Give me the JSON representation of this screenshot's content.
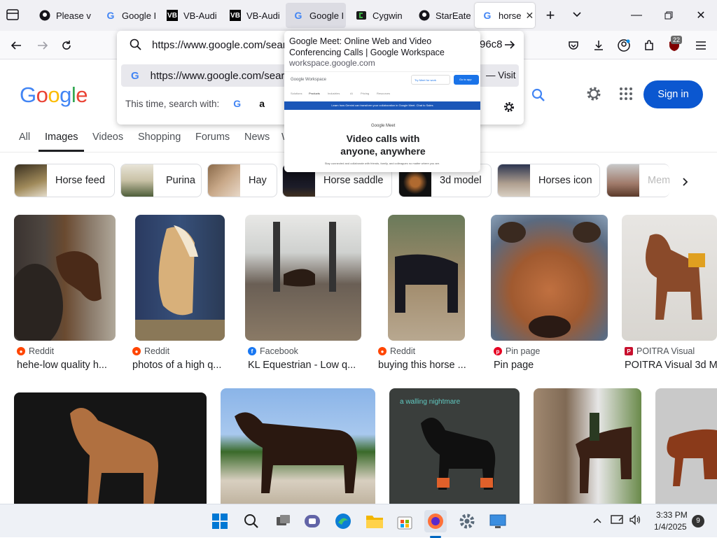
{
  "browser": {
    "tabs": [
      {
        "title": "Please v",
        "icon": "github-icon"
      },
      {
        "title": "Google I",
        "icon": "google-icon"
      },
      {
        "title": "VB-Audi",
        "icon": "vb-audio-icon"
      },
      {
        "title": "VB-Audi",
        "icon": "vb-audio-icon"
      },
      {
        "title": "Google I",
        "icon": "google-icon"
      },
      {
        "title": "Cygwin",
        "icon": "cygwin-icon"
      },
      {
        "title": "StarEate",
        "icon": "github-icon"
      },
      {
        "title": "horse",
        "icon": "google-icon"
      }
    ],
    "new_tab": "+",
    "url": "https://www.google.com/search",
    "url_tail": "96c8",
    "suggestion_url": "https://www.google.com/search",
    "visit_label": "— Visit",
    "search_with_label": "This time, search with:",
    "notif_badge": "22"
  },
  "preview": {
    "title": "Google Meet: Online Web and Video Conferencing Calls | Google Workspace",
    "domain": "workspace.google.com",
    "brand": "Google Workspace",
    "sign_in": "Try Meet for work",
    "cta": "Go to app",
    "menu": [
      "Solutions",
      "Products",
      "Industries",
      "AI",
      "Pricing",
      "Resources"
    ],
    "banner": "Learn how Gemini can transform your collaboration in Google Meet.  Chat to Sales",
    "meet_label": "Google Meet",
    "headline": "Video calls with anyone, anywhere",
    "subtext": "Stay connected and collaborate with friends, family, and colleagues no matter where you are."
  },
  "google": {
    "logo_letters": [
      "G",
      "o",
      "o",
      "g",
      "l",
      "e"
    ],
    "logo_colors": [
      "#4285f4",
      "#ea4335",
      "#fbbc05",
      "#4285f4",
      "#34a853",
      "#ea4335"
    ],
    "sign_in": "Sign in",
    "tabs": [
      "All",
      "Images",
      "Videos",
      "Shopping",
      "Forums",
      "News",
      "W"
    ],
    "chips": [
      "Horse feed",
      "Purina",
      "Hay",
      "Horse saddle",
      "3d model",
      "Horses icon",
      "Mem"
    ],
    "row1": [
      {
        "source": "Reddit",
        "title": "hehe-low quality h...",
        "src_color": "#ff4500"
      },
      {
        "source": "Reddit",
        "title": "photos of a high q...",
        "src_color": "#ff4500"
      },
      {
        "source": "Facebook",
        "title": "KL Equestrian - Low q...",
        "src_color": "#1877f2"
      },
      {
        "source": "Reddit",
        "title": "buying this horse ...",
        "src_color": "#ff4500"
      },
      {
        "source": "Pin page",
        "title": "Pin page",
        "src_color": "#e60023"
      },
      {
        "source": "POITRA Visual",
        "title": "POITRA Visual 3d M",
        "src_color": "#c8102e"
      }
    ],
    "row2_caption": "a walling nightmare"
  },
  "taskbar": {
    "time": "3:33 PM",
    "date": "1/4/2025",
    "notifications": "9"
  },
  "colors": {
    "accent_blue": "#0b57d0",
    "tab_strip": "#f0f0f4"
  }
}
